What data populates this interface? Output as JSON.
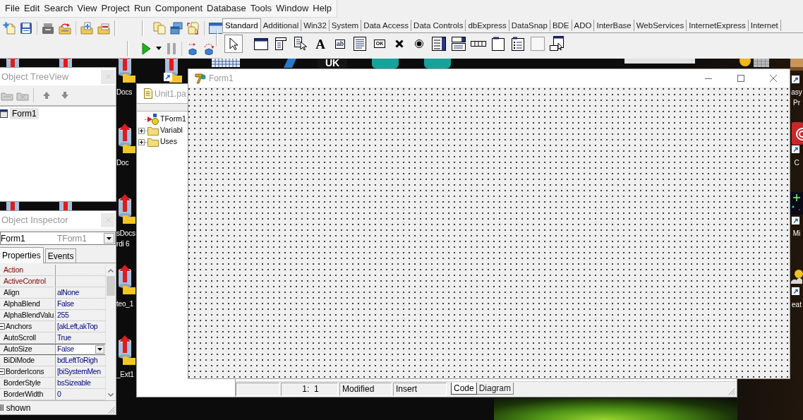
{
  "menu": [
    "File",
    "Edit",
    "Search",
    "View",
    "Project",
    "Run",
    "Component",
    "Database",
    "Tools",
    "Window",
    "Help"
  ],
  "palette": {
    "tabs": [
      {
        "label": "Standard",
        "selected": true
      },
      {
        "label": "Additional",
        "selected": false
      },
      {
        "label": "Win32",
        "selected": false
      },
      {
        "label": "System",
        "selected": false
      },
      {
        "label": "Data Access",
        "selected": false
      },
      {
        "label": "Data Controls",
        "selected": false
      },
      {
        "label": "dbExpress",
        "selected": false
      },
      {
        "label": "DataSnap",
        "selected": false
      },
      {
        "label": "BDE",
        "selected": false
      },
      {
        "label": "ADO",
        "selected": false
      },
      {
        "label": "InterBase",
        "selected": false
      },
      {
        "label": "WebServices",
        "selected": false
      },
      {
        "label": "InternetExpress",
        "selected": false
      },
      {
        "label": "Internet",
        "selected": false
      }
    ],
    "tools": [
      {
        "kind": "pointer",
        "selected": true
      },
      {
        "kind": "frame",
        "selected": false
      },
      {
        "kind": "main_menu",
        "selected": false
      },
      {
        "kind": "popup_menu",
        "selected": false
      },
      {
        "kind": "label",
        "glyph": "A",
        "selected": false
      },
      {
        "kind": "edit",
        "glyph": "ab",
        "selected": false
      },
      {
        "kind": "memo",
        "selected": false
      },
      {
        "kind": "button",
        "glyph": "OK",
        "selected": false
      },
      {
        "kind": "checkbox",
        "selected": false
      },
      {
        "kind": "radio",
        "selected": false
      },
      {
        "kind": "list_box",
        "selected": false
      },
      {
        "kind": "combo_box",
        "selected": false
      },
      {
        "kind": "scroll_bar",
        "selected": false
      },
      {
        "kind": "group_box",
        "selected": false
      },
      {
        "kind": "radio_group",
        "selected": false
      },
      {
        "kind": "panel",
        "selected": false
      },
      {
        "kind": "action_list",
        "selected": false
      }
    ]
  },
  "tree_view": {
    "title": "Object TreeView",
    "items": [
      {
        "label": "Form1",
        "selected": true
      }
    ]
  },
  "inspector": {
    "title": "Object Inspector",
    "object_name": "Form1",
    "object_type": "TForm1",
    "tabs": [
      {
        "label": "Properties",
        "selected": true
      },
      {
        "label": "Events",
        "selected": false
      }
    ],
    "properties": [
      {
        "name": "Action",
        "kind": "reference",
        "selected": false
      },
      {
        "name": "ActiveControl",
        "kind": "reference",
        "selected": false
      },
      {
        "name": "Align",
        "value": "alNone",
        "kind": "plain",
        "selected": false
      },
      {
        "name": "AlphaBlend",
        "value": "False",
        "kind": "plain",
        "selected": false
      },
      {
        "name": "AlphaBlendValu",
        "value": "255",
        "kind": "plain",
        "selected": false
      },
      {
        "name": "Anchors",
        "value": "[akLeft,akTop",
        "kind": "set",
        "selected": false
      },
      {
        "name": "AutoScroll",
        "value": "True",
        "kind": "plain",
        "selected": false
      },
      {
        "name": "AutoSize",
        "value": "False",
        "kind": "plain",
        "selected": true
      },
      {
        "name": "BiDiMode",
        "value": "bdLeftToRigh",
        "kind": "plain",
        "selected": false
      },
      {
        "name": "BorderIcons",
        "value": "[biSystemMen",
        "kind": "set",
        "selected": false
      },
      {
        "name": "BorderStyle",
        "value": "bsSizeable",
        "kind": "plain",
        "selected": false
      },
      {
        "name": "BorderWidth",
        "value": "0",
        "kind": "plain",
        "selected": false
      }
    ],
    "status": "ll shown"
  },
  "code_window": {
    "title": "Unit1.pa",
    "explorer": [
      {
        "kind": "class",
        "label": "TForm1"
      },
      {
        "kind": "folder",
        "label": "Variabl",
        "expanded": false
      },
      {
        "kind": "folder",
        "label": "Uses",
        "expanded": false
      }
    ],
    "status": [
      "1:  1",
      "Modified",
      "Insert"
    ],
    "tabs": [
      {
        "label": "Code",
        "selected": true
      },
      {
        "label": "Diagram",
        "selected": false
      }
    ]
  },
  "form_window": {
    "title": "Form1"
  },
  "desktop": {
    "logo_text": "UK",
    "left_labels": [
      {
        "lines": [
          "Docs"
        ]
      },
      {
        "lines": [
          "Doc"
        ]
      },
      {
        "lines": [
          "sDocs",
          "rdi 6"
        ]
      },
      {
        "lines": [
          "teo_1"
        ]
      },
      {
        "lines": [
          "_Ext1"
        ]
      }
    ],
    "right_labels": [
      {
        "lines": [
          "asy",
          "Pr"
        ]
      },
      {
        "lines": [
          "C"
        ]
      },
      {
        "lines": [
          "Mi"
        ]
      },
      {
        "lines": [
          "eat"
        ]
      }
    ]
  }
}
